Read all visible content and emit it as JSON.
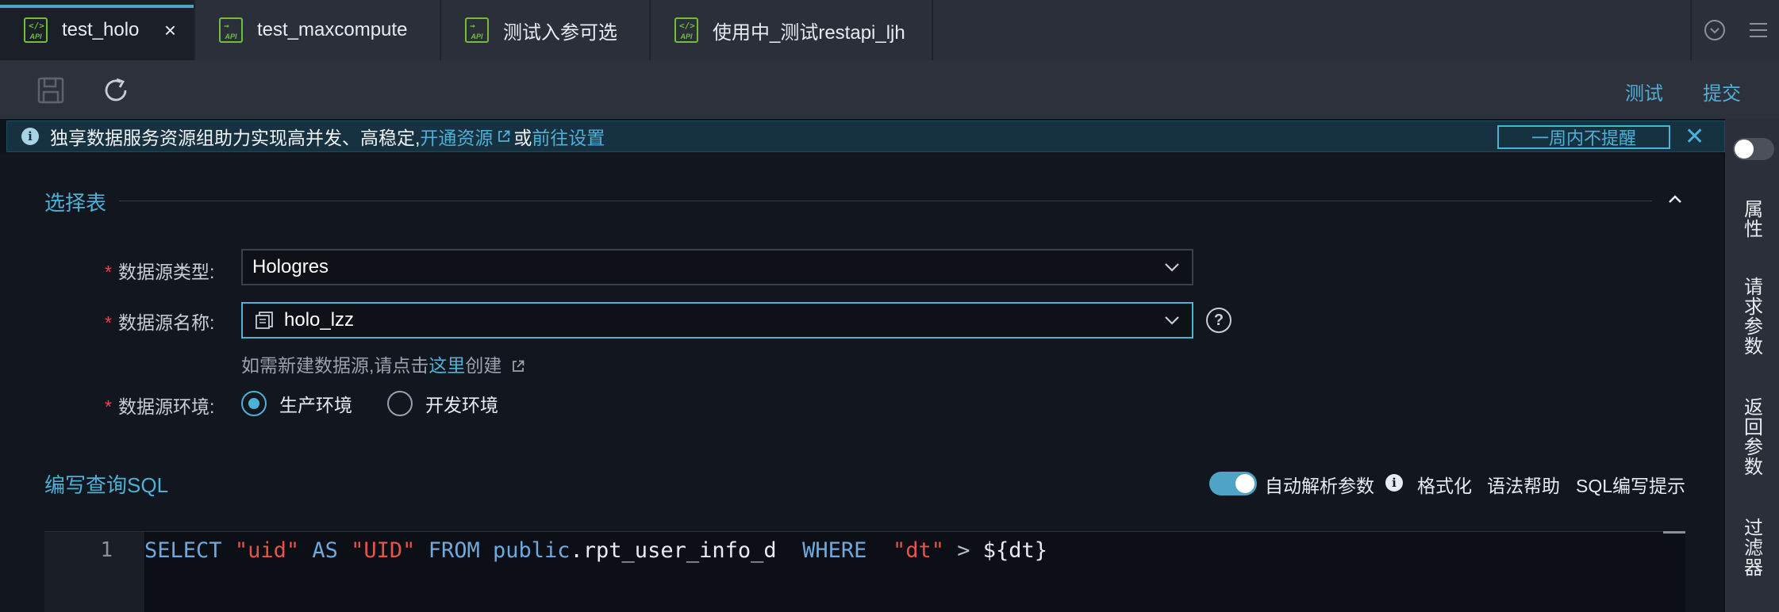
{
  "tabs": [
    {
      "label": "test_holo",
      "icon": "api-icon",
      "active": true,
      "closable": true
    },
    {
      "label": "test_maxcompute",
      "icon": "api-icon",
      "active": false
    },
    {
      "label": "测试入参可选",
      "icon": "api-icon",
      "active": false
    },
    {
      "label": "使用中_测试restapi_ljh",
      "icon": "api-icon",
      "active": false
    }
  ],
  "tab_icon_text": "API",
  "tab_close_glyph": "×",
  "toolbar": {
    "save_icon": "save-icon",
    "refresh_icon": "refresh-icon",
    "test_label": "测试",
    "submit_label": "提交"
  },
  "notice": {
    "info_glyph": "i",
    "message": "独享数据服务资源组助力实现高并发、高稳定,",
    "link_open": "开通资源",
    "or_text": "或",
    "link_settings": "前往设置",
    "remind_button": "一周内不提醒",
    "close_glyph": "✕"
  },
  "select_table": {
    "title": "选择表",
    "required_mark": "*",
    "datasource_type": {
      "label": "数据源类型:",
      "value": "Hologres"
    },
    "datasource_name": {
      "label": "数据源名称:",
      "value": "holo_lzz"
    },
    "help_glyph": "?",
    "hint": {
      "prefix": "如需新建数据源,请点击",
      "link": "这里",
      "suffix": "创建"
    },
    "environment": {
      "label": "数据源环境:",
      "options": [
        {
          "label": "生产环境",
          "checked": true
        },
        {
          "label": "开发环境",
          "checked": false
        }
      ]
    }
  },
  "sql_section": {
    "title": "编写查询SQL",
    "auto_parse": {
      "label": "自动解析参数",
      "on": true
    },
    "info_glyph": "i",
    "format_label": "格式化",
    "syntax_help_label": "语法帮助",
    "sql_tips_label": "SQL编写提示"
  },
  "editor": {
    "line_numbers": [
      "1"
    ],
    "tokens": [
      {
        "t": "SELECT",
        "c": "kw"
      },
      {
        "t": " ",
        "c": ""
      },
      {
        "t": "\"uid\"",
        "c": "str"
      },
      {
        "t": " ",
        "c": ""
      },
      {
        "t": "AS",
        "c": "kw"
      },
      {
        "t": " ",
        "c": ""
      },
      {
        "t": "\"UID\"",
        "c": "str"
      },
      {
        "t": " ",
        "c": ""
      },
      {
        "t": "FROM",
        "c": "kw"
      },
      {
        "t": " ",
        "c": ""
      },
      {
        "t": "public",
        "c": "kw"
      },
      {
        "t": ".rpt_user_info_d  ",
        "c": ""
      },
      {
        "t": "WHERE",
        "c": "kw"
      },
      {
        "t": "  ",
        "c": ""
      },
      {
        "t": "\"dt\"",
        "c": "str"
      },
      {
        "t": " ",
        "c": ""
      },
      {
        "t": ">",
        "c": "op"
      },
      {
        "t": " ${dt}",
        "c": ""
      }
    ]
  },
  "sidebar": {
    "toggle_on": false,
    "items": [
      "属性",
      "请求参数",
      "返回参数",
      "过滤器"
    ]
  },
  "colors": {
    "accent": "#4fb0d6",
    "required": "#e5484d",
    "api_icon": "#6fbf3a",
    "toggle_on": "#4fa4c5"
  }
}
